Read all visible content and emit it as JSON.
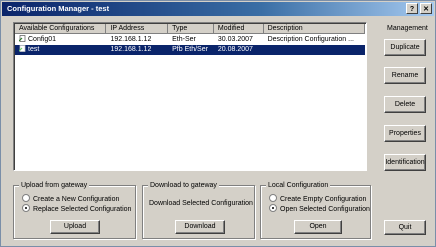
{
  "window": {
    "title": "Configuration Manager - test",
    "help_label": "?",
    "close_label": "✕"
  },
  "list": {
    "columns": [
      "Available Configurations",
      "IP Address",
      "Type",
      "Modified",
      "Description"
    ],
    "rows": [
      {
        "name": "Config01",
        "ip": "192.168.1.12",
        "type": "Eth-Ser",
        "modified": "30.03.2007",
        "description": "Description Configuration ...",
        "selected": false
      },
      {
        "name": "test",
        "ip": "192.168.1.12",
        "type": "Pfb Eth/Ser",
        "modified": "20.08.2007",
        "description": "",
        "selected": true
      }
    ]
  },
  "management": {
    "label": "Management",
    "duplicate": "Duplicate",
    "rename": "Rename",
    "delete": "Delete",
    "properties": "Properties",
    "identification": "Identification"
  },
  "upload": {
    "title": "Upload from gateway",
    "option_new": "Create a New Configuration",
    "option_replace": "Replace Selected Configuration",
    "selected_option": "replace",
    "button": "Upload"
  },
  "download": {
    "title": "Download to gateway",
    "text": "Download Selected Configuration",
    "button": "Download"
  },
  "local": {
    "title": "Local Configuration",
    "option_create": "Create Empty Configuration",
    "option_open": "Open Selected Configuration",
    "selected_option": "open",
    "button": "Open"
  },
  "quit": "Quit",
  "colors": {
    "title_bar": "#0a246a",
    "selection": "#0a246a",
    "face": "#d4d0c8"
  }
}
